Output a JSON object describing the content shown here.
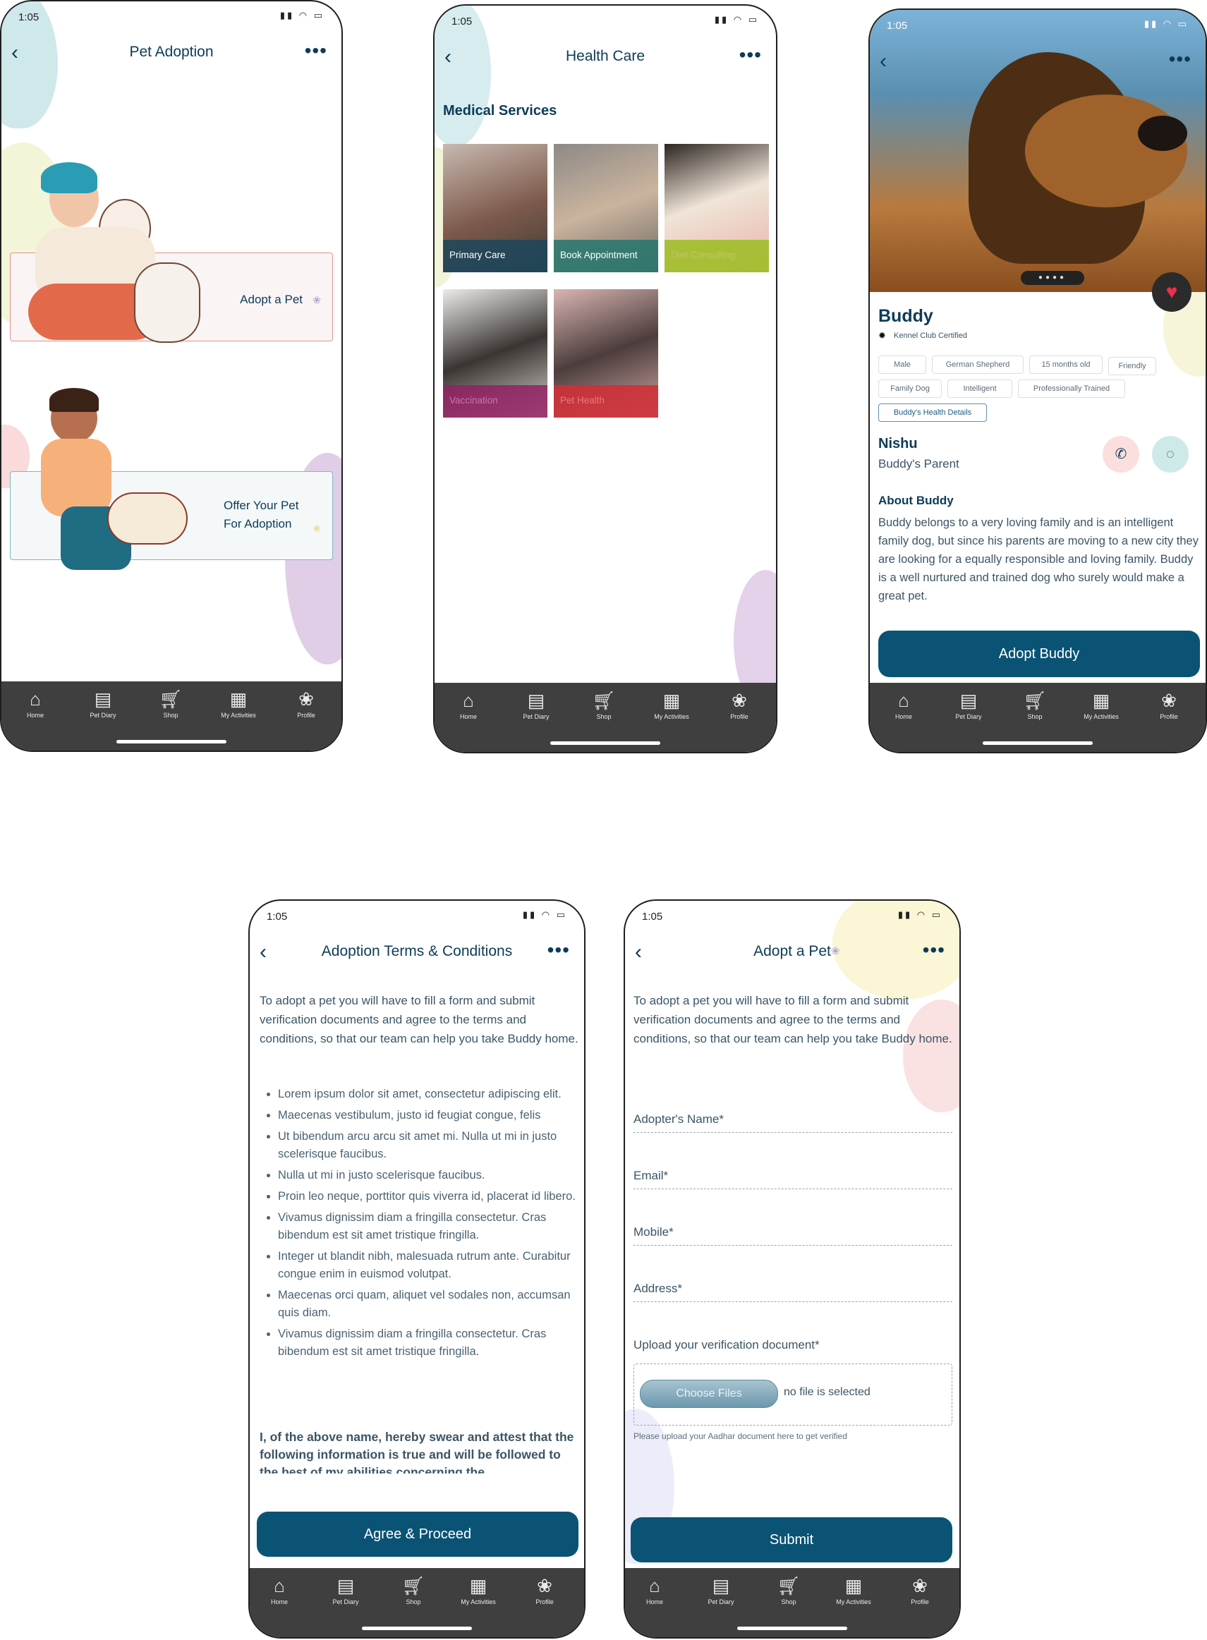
{
  "status_time": "1:05",
  "nav": [
    "Home",
    "Pet Diary",
    "Shop",
    "My Activities",
    "Profile"
  ],
  "screen1": {
    "title": "Pet Adoption",
    "card1": "Adopt a Pet",
    "card2_line1": "Offer Your Pet",
    "card2_line2": "For Adoption"
  },
  "screen2": {
    "title": "Health Care",
    "section": "Medical Services",
    "tiles": [
      "Primary Care",
      "Book Appointment",
      "Diet Consulting",
      "Vaccination",
      "Pet Health"
    ]
  },
  "screen3": {
    "name": "Buddy",
    "certified": "Kennel Club Certified",
    "chips": [
      "Male",
      "German Shepherd",
      "15 months old",
      "Friendly",
      "Family Dog",
      "Intelligent",
      "Professionally Trained"
    ],
    "health_link": "Buddy's Health Details",
    "parent_name": "Nishu",
    "parent_role": "Buddy's Parent",
    "about_title": "About Buddy",
    "about_text": "Buddy belongs to a very loving family and is an intelligent family dog, but since his parents are moving to a new city they are looking for a equally responsible and loving family. Buddy is a well nurtured and trained dog who surely would make a great pet.",
    "cta": "Adopt Buddy"
  },
  "screen4": {
    "title": "Adoption Terms & Conditions",
    "intro": "To adopt a pet you will have to fill a form and submit verification documents and agree to the terms and conditions, so that our team can help you take Buddy home.",
    "terms": [
      "Lorem ipsum dolor sit amet, consectetur adipiscing elit.",
      "Maecenas vestibulum, justo id feugiat congue, felis",
      "Ut bibendum arcu arcu sit amet mi. Nulla ut mi in justo scelerisque faucibus.",
      "Nulla ut mi in justo scelerisque faucibus.",
      "Proin leo neque, porttitor quis viverra id, placerat id libero.",
      "Vivamus dignissim diam a fringilla consectetur. Cras bibendum est sit amet tristique fringilla.",
      "Integer ut blandit nibh, malesuada rutrum ante. Curabitur congue enim in euismod volutpat.",
      "Maecenas orci quam, aliquet vel sodales non, accumsan quis diam.",
      "Vivamus dignissim diam a fringilla consectetur. Cras bibendum est sit amet tristique fringilla."
    ],
    "oath": "I, of the above name, hereby swear and attest that the following information is true and will be followed to the best of my abilities concerning the",
    "cta": "Agree & Proceed"
  },
  "screen5": {
    "title": "Adopt a Pet",
    "intro": "To adopt a pet you will have to fill a form and submit verification documents and agree to the terms and conditions, so that our team can help you take Buddy home.",
    "fields": [
      "Adopter's Name*",
      "Email*",
      "Mobile*",
      "Address*"
    ],
    "upload_label": "Upload your verification document*",
    "choose_files": "Choose Files",
    "no_file": "no file is selected",
    "upload_hint": "Please upload your Aadhar document here to get verified",
    "cta": "Submit"
  }
}
